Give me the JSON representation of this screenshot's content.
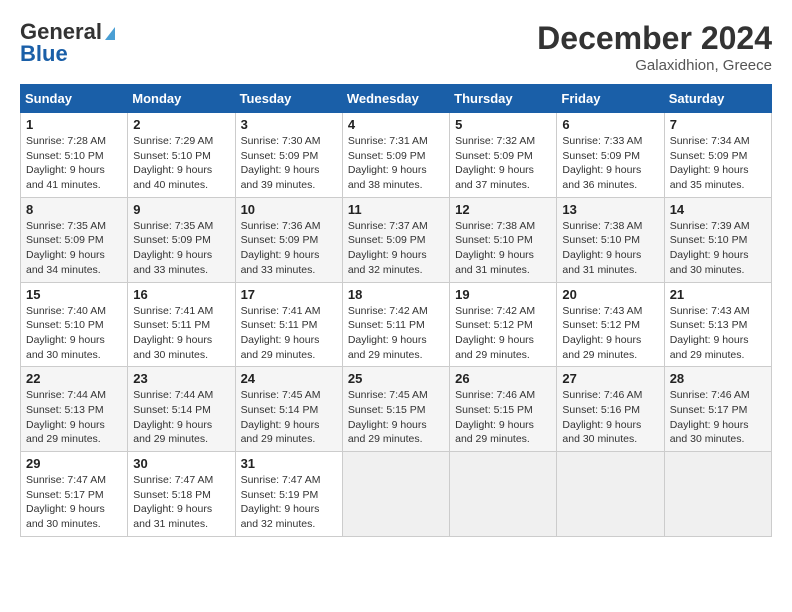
{
  "logo": {
    "line1": "General",
    "line2": "Blue"
  },
  "header": {
    "month": "December 2024",
    "location": "Galaxidhion, Greece"
  },
  "weekdays": [
    "Sunday",
    "Monday",
    "Tuesday",
    "Wednesday",
    "Thursday",
    "Friday",
    "Saturday"
  ],
  "weeks": [
    [
      {
        "day": "1",
        "sunrise": "7:28 AM",
        "sunset": "5:10 PM",
        "daylight": "9 hours and 41 minutes."
      },
      {
        "day": "2",
        "sunrise": "7:29 AM",
        "sunset": "5:10 PM",
        "daylight": "9 hours and 40 minutes."
      },
      {
        "day": "3",
        "sunrise": "7:30 AM",
        "sunset": "5:09 PM",
        "daylight": "9 hours and 39 minutes."
      },
      {
        "day": "4",
        "sunrise": "7:31 AM",
        "sunset": "5:09 PM",
        "daylight": "9 hours and 38 minutes."
      },
      {
        "day": "5",
        "sunrise": "7:32 AM",
        "sunset": "5:09 PM",
        "daylight": "9 hours and 37 minutes."
      },
      {
        "day": "6",
        "sunrise": "7:33 AM",
        "sunset": "5:09 PM",
        "daylight": "9 hours and 36 minutes."
      },
      {
        "day": "7",
        "sunrise": "7:34 AM",
        "sunset": "5:09 PM",
        "daylight": "9 hours and 35 minutes."
      }
    ],
    [
      {
        "day": "8",
        "sunrise": "7:35 AM",
        "sunset": "5:09 PM",
        "daylight": "9 hours and 34 minutes."
      },
      {
        "day": "9",
        "sunrise": "7:35 AM",
        "sunset": "5:09 PM",
        "daylight": "9 hours and 33 minutes."
      },
      {
        "day": "10",
        "sunrise": "7:36 AM",
        "sunset": "5:09 PM",
        "daylight": "9 hours and 33 minutes."
      },
      {
        "day": "11",
        "sunrise": "7:37 AM",
        "sunset": "5:09 PM",
        "daylight": "9 hours and 32 minutes."
      },
      {
        "day": "12",
        "sunrise": "7:38 AM",
        "sunset": "5:10 PM",
        "daylight": "9 hours and 31 minutes."
      },
      {
        "day": "13",
        "sunrise": "7:38 AM",
        "sunset": "5:10 PM",
        "daylight": "9 hours and 31 minutes."
      },
      {
        "day": "14",
        "sunrise": "7:39 AM",
        "sunset": "5:10 PM",
        "daylight": "9 hours and 30 minutes."
      }
    ],
    [
      {
        "day": "15",
        "sunrise": "7:40 AM",
        "sunset": "5:10 PM",
        "daylight": "9 hours and 30 minutes."
      },
      {
        "day": "16",
        "sunrise": "7:41 AM",
        "sunset": "5:11 PM",
        "daylight": "9 hours and 30 minutes."
      },
      {
        "day": "17",
        "sunrise": "7:41 AM",
        "sunset": "5:11 PM",
        "daylight": "9 hours and 29 minutes."
      },
      {
        "day": "18",
        "sunrise": "7:42 AM",
        "sunset": "5:11 PM",
        "daylight": "9 hours and 29 minutes."
      },
      {
        "day": "19",
        "sunrise": "7:42 AM",
        "sunset": "5:12 PM",
        "daylight": "9 hours and 29 minutes."
      },
      {
        "day": "20",
        "sunrise": "7:43 AM",
        "sunset": "5:12 PM",
        "daylight": "9 hours and 29 minutes."
      },
      {
        "day": "21",
        "sunrise": "7:43 AM",
        "sunset": "5:13 PM",
        "daylight": "9 hours and 29 minutes."
      }
    ],
    [
      {
        "day": "22",
        "sunrise": "7:44 AM",
        "sunset": "5:13 PM",
        "daylight": "9 hours and 29 minutes."
      },
      {
        "day": "23",
        "sunrise": "7:44 AM",
        "sunset": "5:14 PM",
        "daylight": "9 hours and 29 minutes."
      },
      {
        "day": "24",
        "sunrise": "7:45 AM",
        "sunset": "5:14 PM",
        "daylight": "9 hours and 29 minutes."
      },
      {
        "day": "25",
        "sunrise": "7:45 AM",
        "sunset": "5:15 PM",
        "daylight": "9 hours and 29 minutes."
      },
      {
        "day": "26",
        "sunrise": "7:46 AM",
        "sunset": "5:15 PM",
        "daylight": "9 hours and 29 minutes."
      },
      {
        "day": "27",
        "sunrise": "7:46 AM",
        "sunset": "5:16 PM",
        "daylight": "9 hours and 30 minutes."
      },
      {
        "day": "28",
        "sunrise": "7:46 AM",
        "sunset": "5:17 PM",
        "daylight": "9 hours and 30 minutes."
      }
    ],
    [
      {
        "day": "29",
        "sunrise": "7:47 AM",
        "sunset": "5:17 PM",
        "daylight": "9 hours and 30 minutes."
      },
      {
        "day": "30",
        "sunrise": "7:47 AM",
        "sunset": "5:18 PM",
        "daylight": "9 hours and 31 minutes."
      },
      {
        "day": "31",
        "sunrise": "7:47 AM",
        "sunset": "5:19 PM",
        "daylight": "9 hours and 32 minutes."
      },
      null,
      null,
      null,
      null
    ]
  ],
  "labels": {
    "sunrise": "Sunrise:",
    "sunset": "Sunset:",
    "daylight": "Daylight:"
  }
}
